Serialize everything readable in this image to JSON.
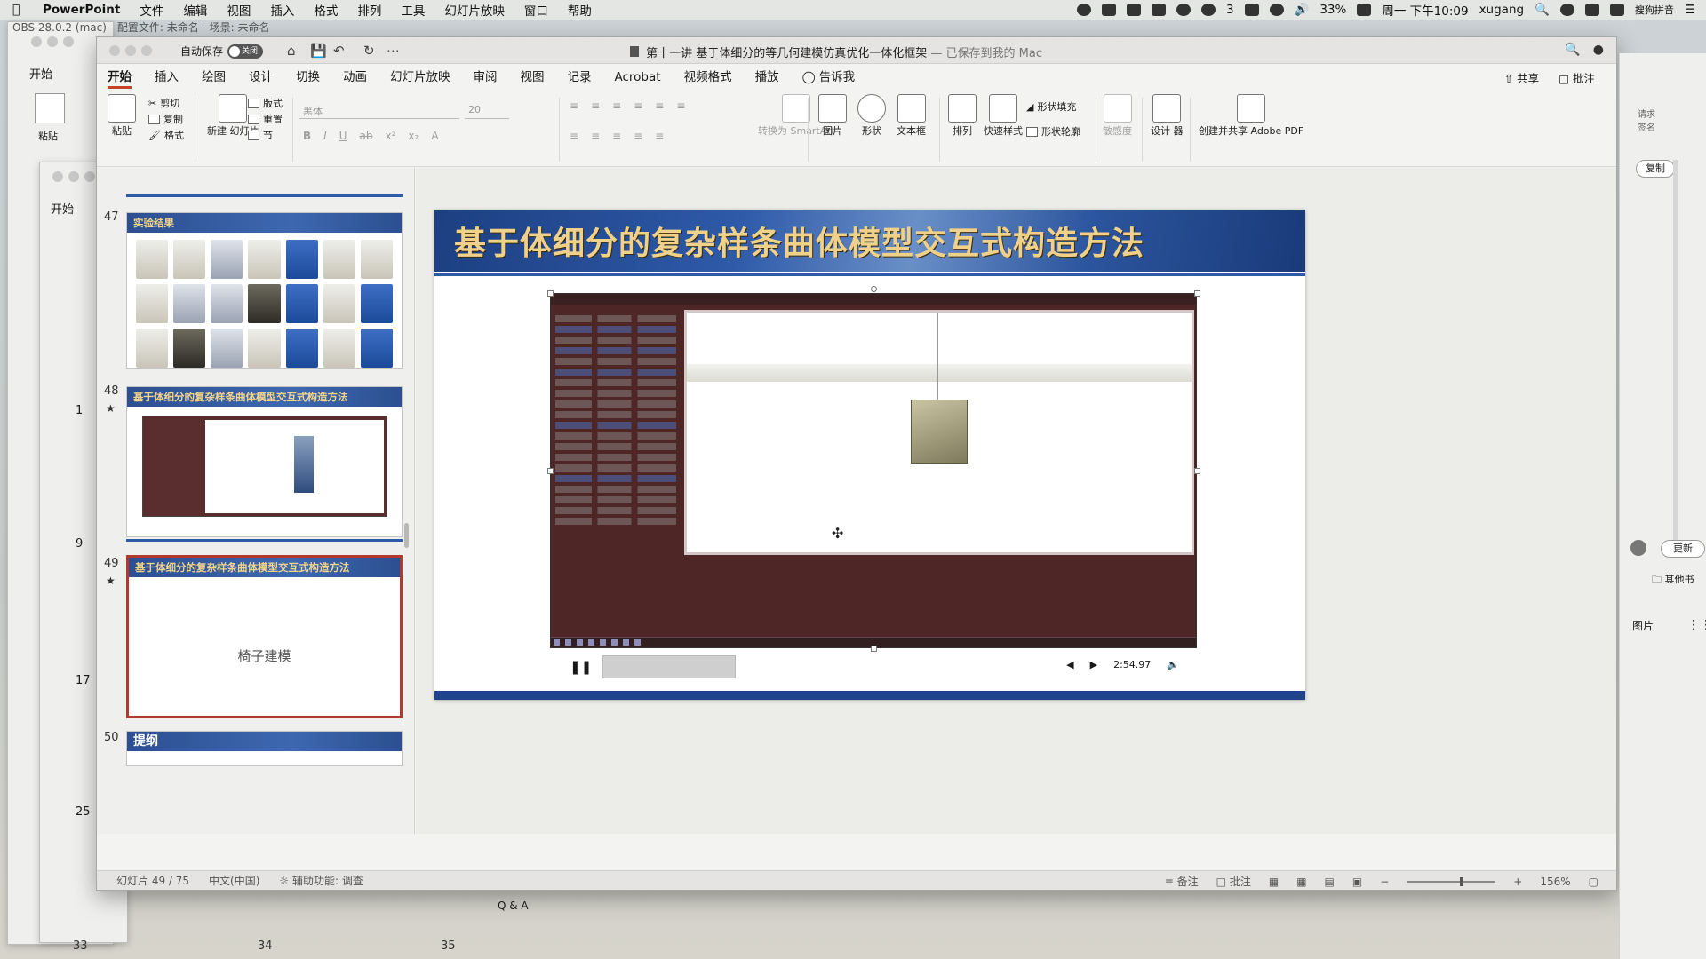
{
  "menubar": {
    "app": "PowerPoint",
    "items": [
      "文件",
      "编辑",
      "视图",
      "插入",
      "格式",
      "排列",
      "工具",
      "幻灯片放映",
      "窗口",
      "帮助"
    ],
    "battery": "33%",
    "datetime": "周一 下午10:09",
    "user": "xugang",
    "wechat_badge": "3",
    "ime": "搜狗拼音"
  },
  "bg_window": {
    "title": "OBS 28.0.2 (mac) - 配置文件: 未命名 - 场景: 未命名",
    "tab_start": "开始",
    "paste": "粘贴",
    "thumb_nums": [
      "1",
      "9",
      "17",
      "25",
      "33"
    ]
  },
  "window": {
    "autosave_label": "自动保存",
    "autosave_state": "关闭",
    "title": "第十一讲 基于体细分的等几何建模仿真优化一体化框架",
    "saved_status": "— 已保存到我的 Mac"
  },
  "tabs": [
    "开始",
    "插入",
    "绘图",
    "设计",
    "切换",
    "动画",
    "幻灯片放映",
    "审阅",
    "视图",
    "记录",
    "Acrobat",
    "视频格式",
    "播放"
  ],
  "tell_me": "告诉我",
  "share": "共享",
  "comment": "批注",
  "ribbon": {
    "paste": "粘贴",
    "cut": "剪切",
    "copy": "复制",
    "format": "格式",
    "new_slide": "新建\n幻灯片",
    "layout": "版式",
    "reset": "重置",
    "section": "节",
    "font": "黑体",
    "font_size": "20",
    "convert_smartart": "转换为\nSmartArt",
    "picture": "图片",
    "shape": "形状",
    "textbox": "文本框",
    "arrange": "排列",
    "quick_styles": "快速样式",
    "shape_fill": "形状填充",
    "shape_outline": "形状轮廓",
    "sensitivity": "敏感度",
    "designer": "设计\n器",
    "create_pdf": "创建并共享\nAdobe PDF"
  },
  "thumbnails": [
    {
      "num": "47",
      "title": "实验结果"
    },
    {
      "num": "48",
      "title": "基于体细分的复杂样条曲体模型交互式构造方法"
    },
    {
      "num": "49",
      "title": "基于体细分的复杂样条曲体模型交互式构造方法",
      "body": "椅子建模"
    },
    {
      "num": "50",
      "title": "提纲"
    }
  ],
  "slide": {
    "title": "基于体细分的复杂样条曲体模型交互式构造方法"
  },
  "video": {
    "time": "2:54.97"
  },
  "statusbar": {
    "slide_count": "幻灯片 49 / 75",
    "language": "中文(中国)",
    "accessibility": "辅助功能: 调查",
    "notes": "备注",
    "comments": "批注",
    "zoom": "156%"
  },
  "right_panel": {
    "copy": "复制",
    "update": "更新",
    "other": "其他书",
    "picture": "图片",
    "sign": "请求\n签名"
  },
  "qa_label": "Q & A",
  "bottom_numbers": [
    "33",
    "34",
    "35"
  ]
}
